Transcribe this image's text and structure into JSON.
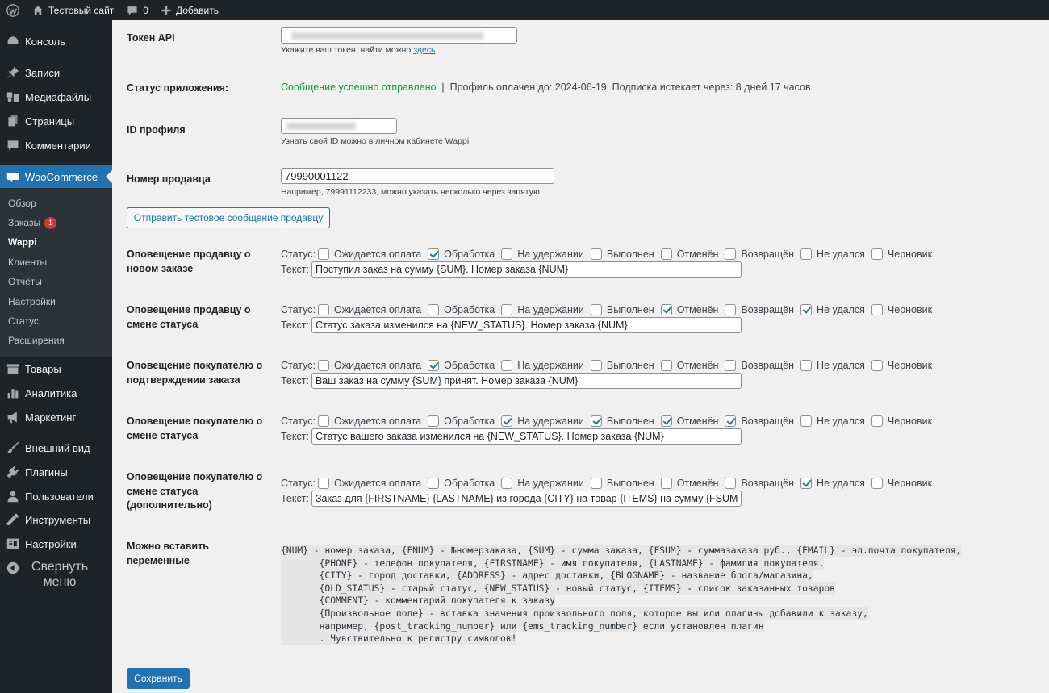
{
  "adminbar": {
    "site_name": "Тестовый сайт",
    "comments_count": "0",
    "add_new": "Добавить"
  },
  "sidebar": {
    "items": [
      {
        "label": "Консоль",
        "icon": "dashboard-icon"
      },
      {
        "label": "Записи",
        "icon": "pin-icon"
      },
      {
        "label": "Медиафайлы",
        "icon": "media-icon"
      },
      {
        "label": "Страницы",
        "icon": "page-icon"
      },
      {
        "label": "Комментарии",
        "icon": "comment-icon"
      },
      {
        "label": "WooCommerce",
        "icon": "woo-icon"
      },
      {
        "label": "Товары",
        "icon": "archive-icon"
      },
      {
        "label": "Аналитика",
        "icon": "bar-chart-icon"
      },
      {
        "label": "Маркетинг",
        "icon": "megaphone-icon"
      },
      {
        "label": "Внешний вид",
        "icon": "brush-icon"
      },
      {
        "label": "Плагины",
        "icon": "plug-icon"
      },
      {
        "label": "Пользователи",
        "icon": "user-icon"
      },
      {
        "label": "Инструменты",
        "icon": "wrench-icon"
      },
      {
        "label": "Настройки",
        "icon": "settings-icon"
      }
    ],
    "submenu": [
      {
        "label": "Обзор"
      },
      {
        "label": "Заказы",
        "badge": "1"
      },
      {
        "label": "Wappi"
      },
      {
        "label": "Клиенты"
      },
      {
        "label": "Отчёты"
      },
      {
        "label": "Настройки"
      },
      {
        "label": "Статус"
      },
      {
        "label": "Расширения"
      }
    ],
    "collapse_label": "Свернуть меню"
  },
  "settings": {
    "token": {
      "label": "Токен API",
      "value": "",
      "hint": "Укажите ваш токен, найти можно",
      "hint_link": "здесь"
    },
    "app_status": {
      "label": "Статус приложения:",
      "ok_message": "Сообщение успешно отправлено",
      "separator": "|",
      "details": "Профиль оплачен до: 2024-06-19, Подписка истекает через: 8 дней 17 часов"
    },
    "profile_id": {
      "label": "ID профиля",
      "value": "",
      "hint": "Узнать свой ID можно в личном кабинете Wappi"
    },
    "seller_number": {
      "label": "Номер продавца",
      "value": "79990001122",
      "hint": "Например, 79991112233, можно указать несколько через запятую."
    },
    "test_button": "Отправить тестовое сообщение продавцу",
    "status_prefix": "Статус:",
    "text_prefix": "Текст:",
    "status_names": [
      "Ожидается оплата",
      "Обработка",
      "На удержании",
      "Выполнен",
      "Отменён",
      "Возвращён",
      "Не удался",
      "Черновик"
    ],
    "notifications": [
      {
        "label_lines": [
          "Оповещение продавцу о",
          "новом заказе"
        ],
        "checked": [
          false,
          true,
          false,
          false,
          false,
          false,
          false,
          false
        ],
        "text": "Поступил заказ на сумму {SUM}. Номер заказа {NUM}"
      },
      {
        "label_lines": [
          "Оповещение продавцу о",
          "смене статуса"
        ],
        "checked": [
          false,
          false,
          false,
          false,
          true,
          false,
          true,
          false
        ],
        "text": "Статус заказа изменился на {NEW_STATUS}. Номер заказа {NUM}"
      },
      {
        "label_lines": [
          "Оповещение покупателю о",
          "подтверждении заказа"
        ],
        "checked": [
          false,
          true,
          false,
          false,
          false,
          false,
          false,
          false
        ],
        "text": "Ваш заказ на сумму {SUM} принят. Номер заказа {NUM}"
      },
      {
        "label_lines": [
          "Оповещение покупателю о",
          "смене статуса"
        ],
        "checked": [
          false,
          false,
          true,
          true,
          true,
          true,
          false,
          false
        ],
        "text": "Статус вашего заказа изменился на {NEW_STATUS}. Номер заказа {NUM}"
      },
      {
        "label_lines": [
          "Оповещение покупателю о",
          "смене статуса",
          "(дополнительно)"
        ],
        "checked": [
          false,
          false,
          false,
          false,
          false,
          false,
          true,
          false
        ],
        "text": "Заказ для {FIRSTNAME} {LASTNAME} из города {CITY} на товар {ITEMS} на сумму {FSUM} p"
      }
    ],
    "variables": {
      "label_lines": [
        "Можно вставить",
        "переменные"
      ],
      "lines": [
        "{NUM} - номер заказа, {FNUM} - №номерзаказа, {SUM} - сумма заказа, {FSUM} - суммазаказа руб., {EMAIL} - эл.почта покупателя,",
        "       {PHONE} - телефон покупателя, {FIRSTNAME} - имя покупателя, {LASTNAME} - фамилия покупателя,",
        "       {CITY} - город доставки, {ADDRESS} - адрес доставки, {BLOGNAME} - название блога/магазина,",
        "       {OLD_STATUS} - старый статус, {NEW_STATUS} - новый статус, {ITEMS} - список заказанных товаров",
        "       {COMMENT} - комментарий покупателя к заказу",
        "       {Произвольное поле} - вставка значения произвольного поля, которое вы или плагины добавили к заказу,",
        "       например, {post_tracking_number} или {ems_tracking_number} если установлен плагин",
        "       . Чувствительно к регистру символов!"
      ]
    },
    "save_button": "Сохранить"
  }
}
